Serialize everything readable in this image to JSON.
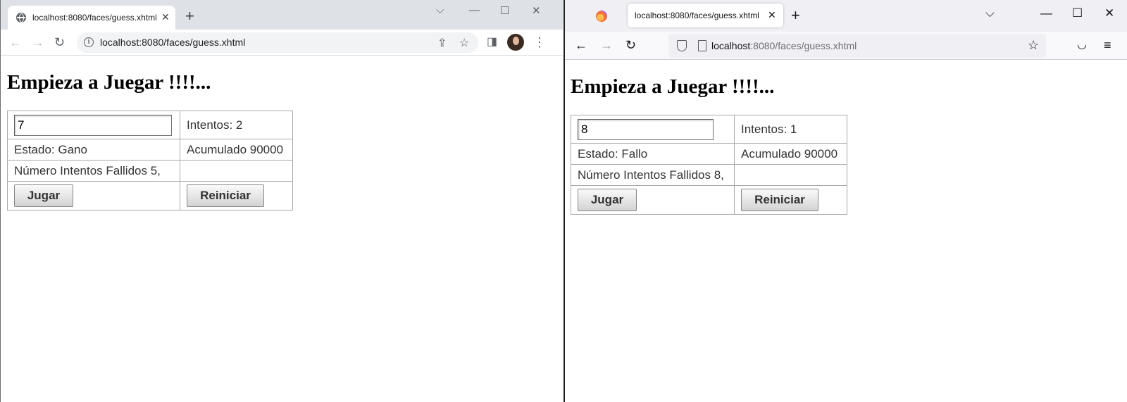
{
  "chrome": {
    "tab_title": "localhost:8080/faces/guess.xhtml",
    "url": "localhost:8080/faces/guess.xhtml",
    "page": {
      "heading": "Empieza a Juegar !!!!...",
      "number_value": "7",
      "intentos": "Intentos: 2",
      "estado": "Estado: Gano",
      "acumulado": "Acumulado 90000",
      "fallidos": "Número Intentos Fallidos 5,",
      "jugar_label": "Jugar",
      "reiniciar_label": "Reiniciar"
    }
  },
  "firefox": {
    "tab_title": "localhost:8080/faces/guess.xhtml",
    "url_host": "localhost",
    "url_path": ":8080/faces/guess.xhtml",
    "page": {
      "heading": "Empieza a Juegar !!!!...",
      "number_value": "8",
      "intentos": "Intentos: 1",
      "estado": "Estado: Fallo",
      "acumulado": "Acumulado 90000",
      "fallidos": "Número Intentos Fallidos 8,",
      "jugar_label": "Jugar",
      "reiniciar_label": "Reiniciar"
    }
  },
  "icons": {
    "chrome": [
      "globe-icon",
      "close-icon",
      "new-tab-icon",
      "chevron-down-icon",
      "minimize-icon",
      "maximize-icon",
      "close-window-icon",
      "back-icon",
      "forward-icon",
      "reload-icon",
      "info-icon",
      "share-icon",
      "star-icon",
      "side-panel-icon",
      "avatar",
      "menu-icon"
    ],
    "firefox": [
      "firefox-logo-icon",
      "close-icon",
      "new-tab-icon",
      "chevron-down-icon",
      "minimize-icon",
      "maximize-icon",
      "close-window-icon",
      "back-icon",
      "forward-icon",
      "reload-icon",
      "shield-icon",
      "page-icon",
      "star-icon",
      "pocket-icon",
      "menu-icon"
    ]
  }
}
